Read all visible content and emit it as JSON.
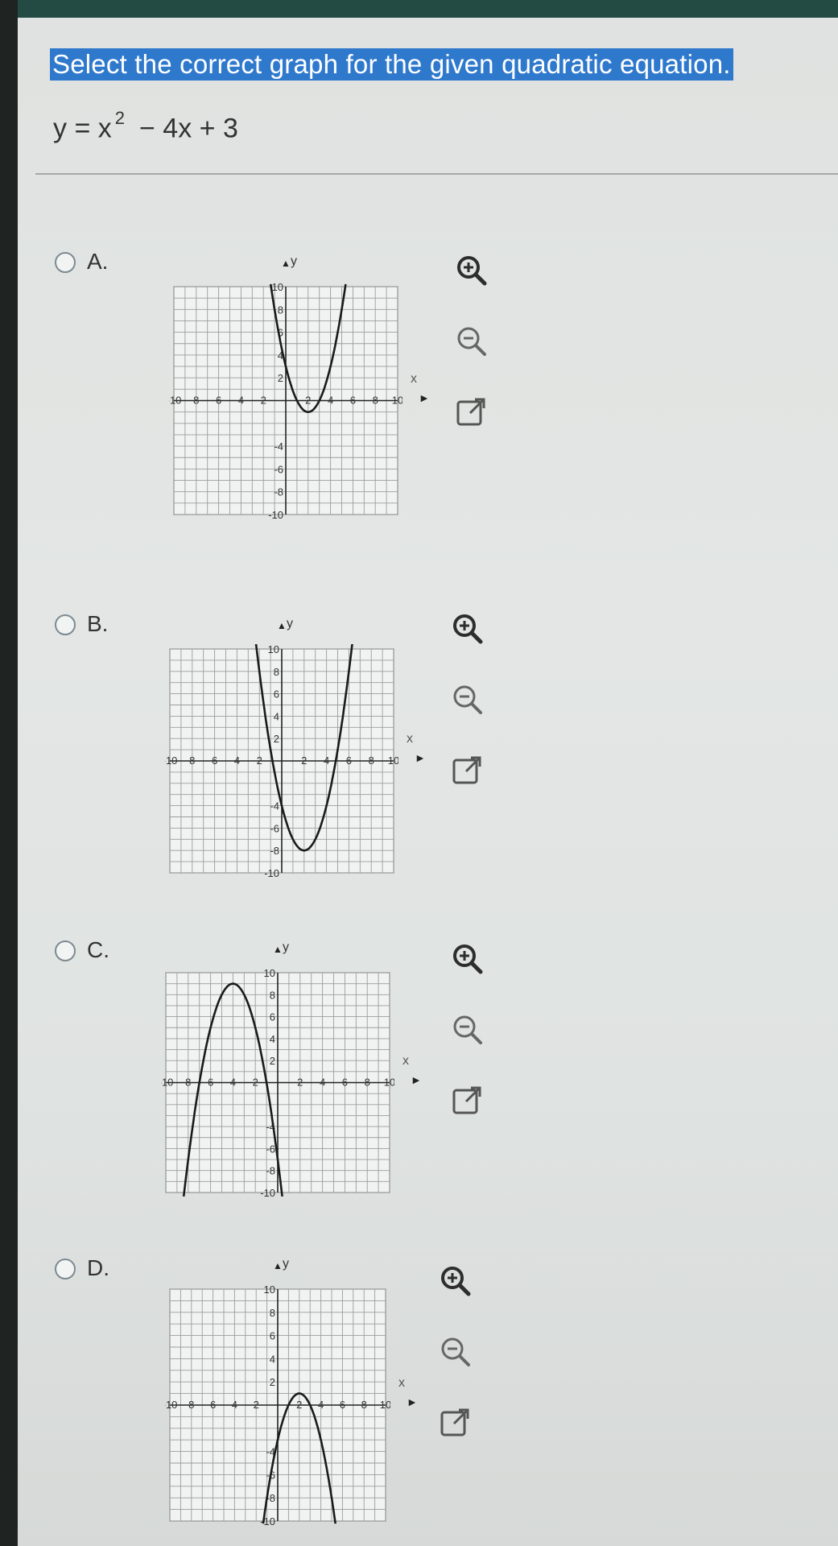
{
  "question": {
    "prompt": "Select the correct graph for the given quadratic equation.",
    "equation_prefix": "y = x",
    "equation_exponent": "2",
    "equation_suffix": "− 4x + 3"
  },
  "axis_labels": {
    "x": "x",
    "y": "y",
    "x_ticks": [
      "-10",
      "8",
      "6",
      "4",
      "2",
      "2",
      "4",
      "6",
      "8",
      "10"
    ],
    "y_ticks": [
      "10",
      "8",
      "6",
      "4",
      "2",
      "-4",
      "-6",
      "-8",
      "-10"
    ]
  },
  "options": [
    {
      "letter": "A.",
      "curve": "upward parabola, vertex near (2, -1)"
    },
    {
      "letter": "B.",
      "curve": "upward parabola, vertex near (2, -8)"
    },
    {
      "letter": "C.",
      "curve": "downward parabola, vertex near (-4, 9)"
    },
    {
      "letter": "D.",
      "curve": "downward parabola, vertex near (2, 1)"
    }
  ],
  "tool_icons": [
    "zoom-in-icon",
    "zoom-out-icon",
    "popout-icon"
  ]
}
